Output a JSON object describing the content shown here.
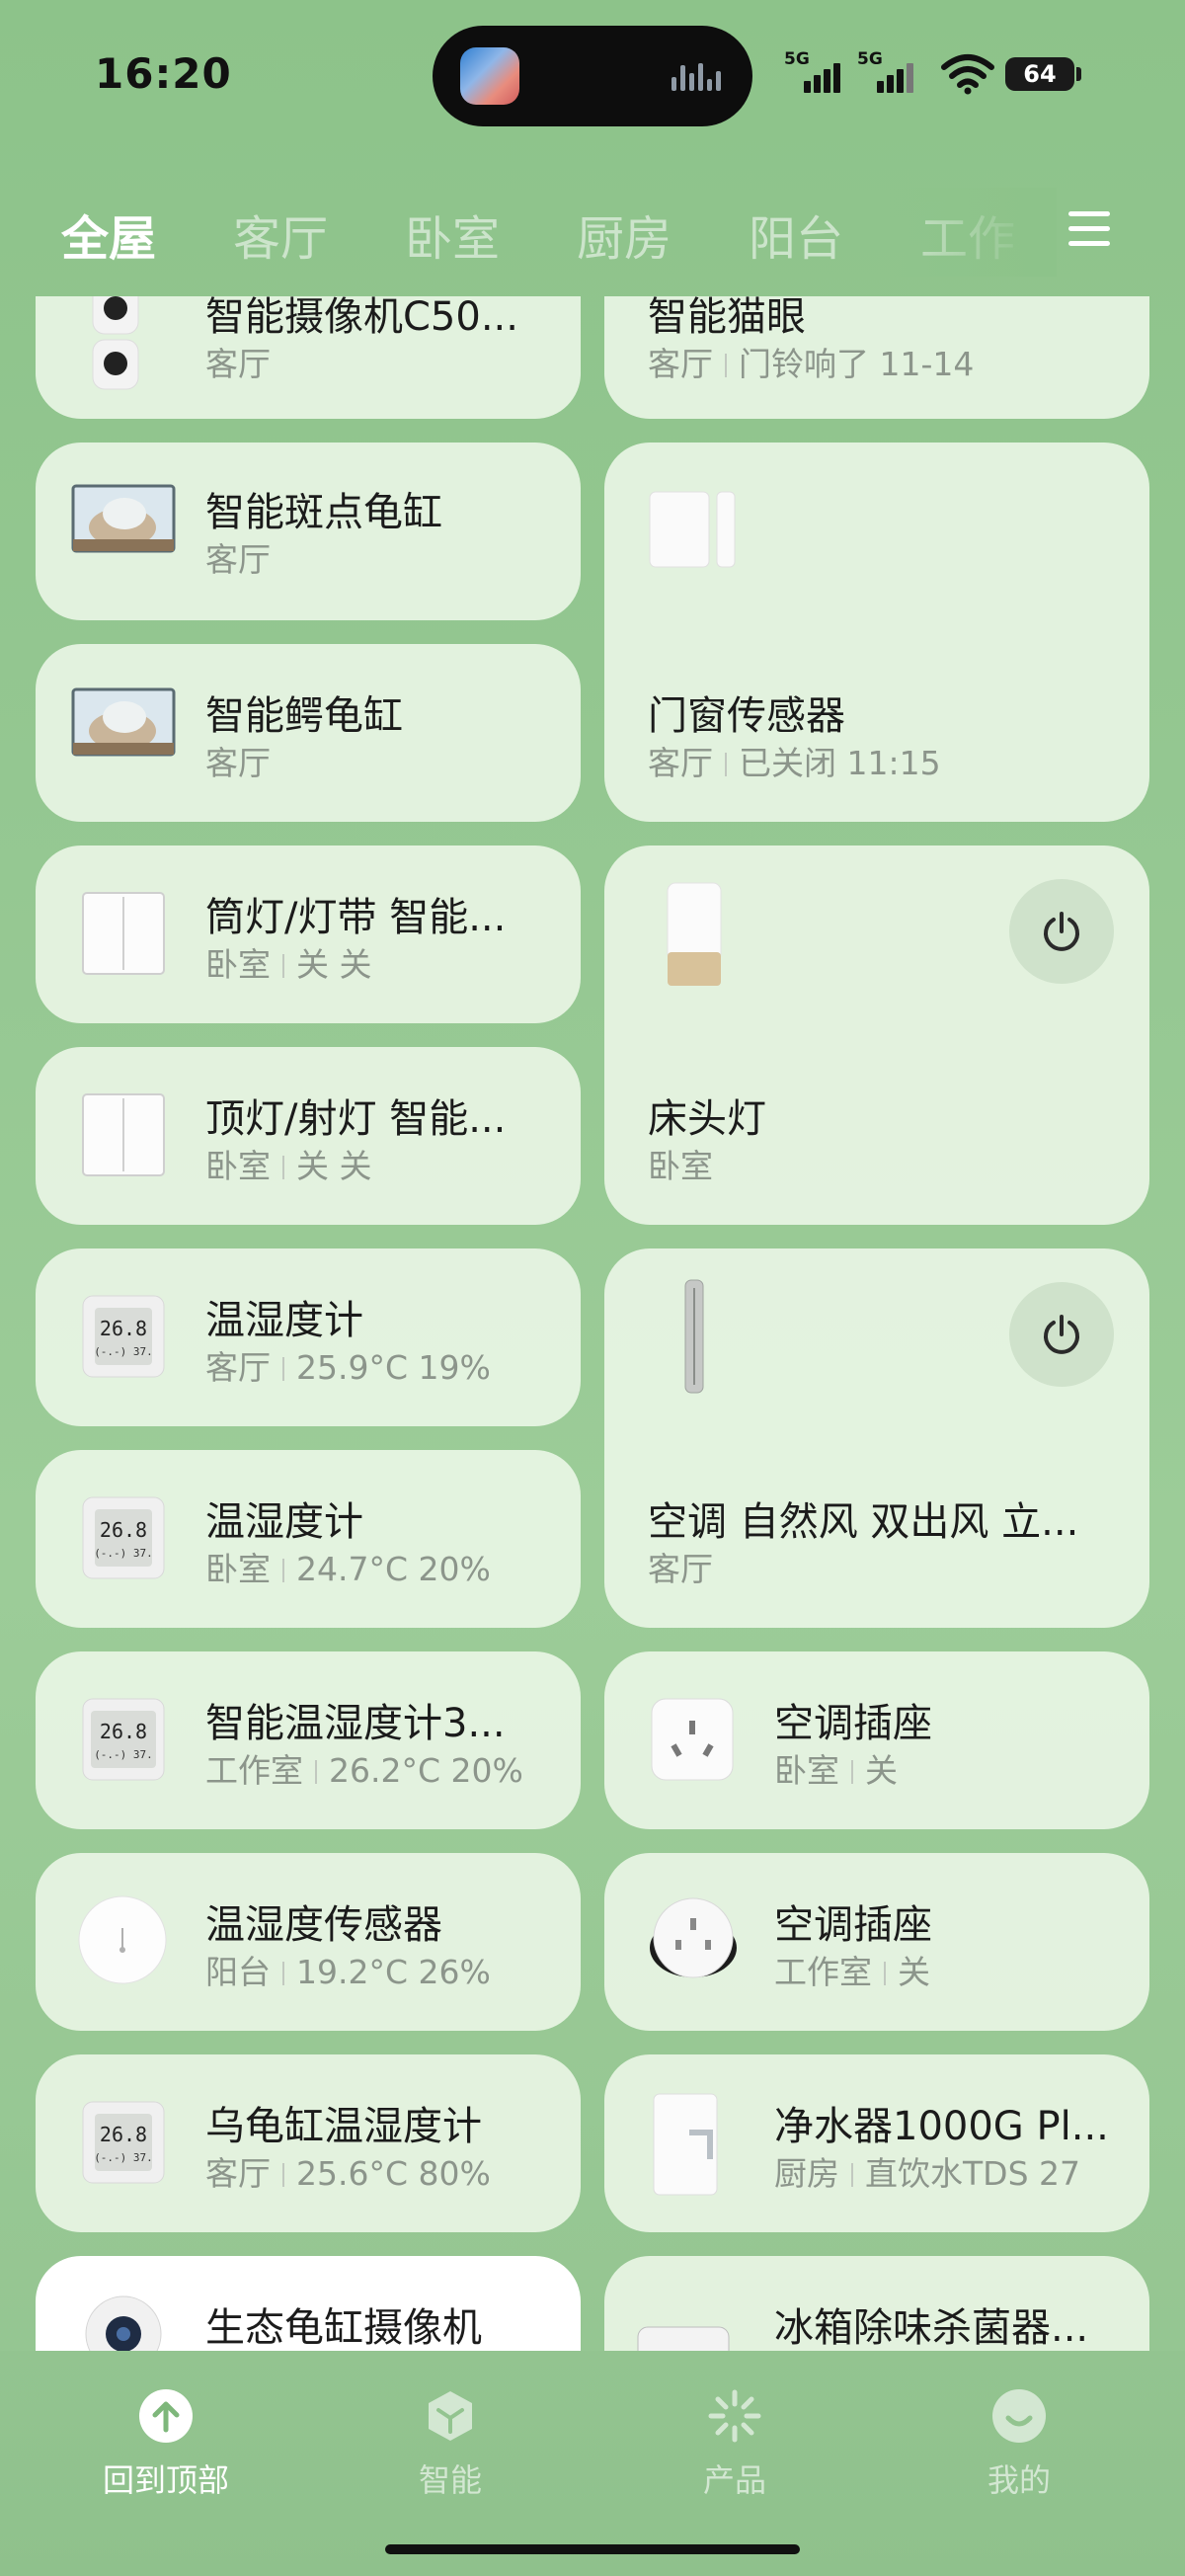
{
  "status": {
    "time": "16:20",
    "signal1": "5G",
    "signal2": "5G",
    "battery": "64"
  },
  "tabs": [
    "全屋",
    "客厅",
    "卧室",
    "厨房",
    "阳台",
    "工作"
  ],
  "cards": [
    {
      "title": "智能摄像机C50...",
      "room": "客厅",
      "state": ""
    },
    {
      "title": "智能猫眼",
      "room": "客厅",
      "state": "门铃响了 11-14"
    },
    {
      "title": "智能斑点龟缸",
      "room": "客厅",
      "state": ""
    },
    {
      "title": "门窗传感器",
      "room": "客厅",
      "state": "已关闭 11:15"
    },
    {
      "title": "智能鳄龟缸",
      "room": "客厅",
      "state": ""
    },
    {
      "title": "筒灯/灯带 智能...",
      "room": "卧室",
      "state": "关 关"
    },
    {
      "title": "床头灯",
      "room": "卧室",
      "state": ""
    },
    {
      "title": "顶灯/射灯 智能...",
      "room": "卧室",
      "state": "关 关"
    },
    {
      "title": "温湿度计",
      "room": "客厅",
      "state": "25.9°C 19%"
    },
    {
      "title": "空调 自然风 双出风 立...",
      "room": "客厅",
      "state": ""
    },
    {
      "title": "温湿度计",
      "room": "卧室",
      "state": "24.7°C 20%"
    },
    {
      "title": "智能温湿度计3...",
      "room": "工作室",
      "state": "26.2°C 20%"
    },
    {
      "title": "空调插座",
      "room": "卧室",
      "state": "关"
    },
    {
      "title": "温湿度传感器",
      "room": "阳台",
      "state": "19.2°C 26%"
    },
    {
      "title": "空调插座",
      "room": "工作室",
      "state": "关"
    },
    {
      "title": "乌龟缸温湿度计",
      "room": "客厅",
      "state": "25.6°C 80%"
    },
    {
      "title": "净水器1000G Pl...",
      "room": "厨房",
      "state": "直饮水TDS 27"
    },
    {
      "title": "生态龟缸摄像机",
      "room": "",
      "state": ""
    },
    {
      "title": "冰箱除味杀菌器...",
      "room": "",
      "state": ""
    }
  ],
  "nav": [
    {
      "label": "回到顶部",
      "icon": "arrow-up-icon"
    },
    {
      "label": "智能",
      "icon": "hexagon-icon"
    },
    {
      "label": "产品",
      "icon": "sparkle-icon"
    },
    {
      "label": "我的",
      "icon": "smile-icon"
    }
  ]
}
